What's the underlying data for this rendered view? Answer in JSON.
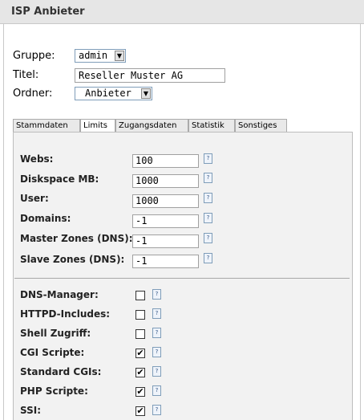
{
  "page": {
    "title": "ISP Anbieter"
  },
  "form": {
    "gruppe_label": "Gruppe:",
    "gruppe_value": "admin",
    "titel_label": "Titel:",
    "titel_value": "Reseller Muster AG",
    "ordner_label": "Ordner:",
    "ordner_value": "Anbieter"
  },
  "tabs": [
    "Stammdaten",
    "Limits",
    "Zugangsdaten",
    "Statistik",
    "Sonstiges"
  ],
  "active_tab": "Limits",
  "limits": [
    {
      "label": "Webs:",
      "value": "100"
    },
    {
      "label": "Diskspace MB:",
      "value": "1000"
    },
    {
      "label": "User:",
      "value": "1000"
    },
    {
      "label": "Domains:",
      "value": "-1"
    },
    {
      "label": "Master Zones (DNS):",
      "value": "-1"
    },
    {
      "label": "Slave Zones (DNS):",
      "value": "-1"
    }
  ],
  "options": [
    {
      "label": "DNS-Manager:",
      "checked": false
    },
    {
      "label": "HTTPD-Includes:",
      "checked": false
    },
    {
      "label": "Shell Zugriff:",
      "checked": false
    },
    {
      "label": "CGI Scripte:",
      "checked": true
    },
    {
      "label": "Standard CGIs:",
      "checked": true
    },
    {
      "label": "PHP Scripte:",
      "checked": true
    },
    {
      "label": "SSI:",
      "checked": true
    }
  ],
  "icons": {
    "help": "help-doc-icon",
    "dropdown": "dropdown-arrow-icon"
  }
}
